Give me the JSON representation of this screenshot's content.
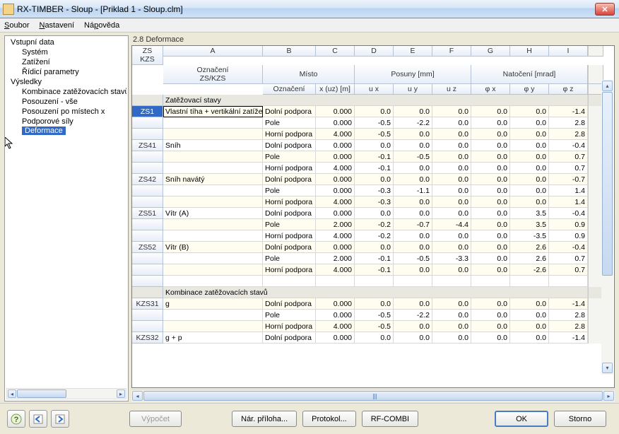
{
  "window": {
    "title": "RX-TIMBER - Sloup - [Priklad 1 - Sloup.clm]"
  },
  "menu": {
    "file": "Soubor",
    "settings": "Nastavení",
    "help": "Nápověda"
  },
  "tree": {
    "group1": "Vstupní data",
    "items1": [
      "Systém",
      "Zatížení",
      "Řídicí parametry"
    ],
    "group2": "Výsledky",
    "items2": [
      "Kombinace zatěžovacích stavů",
      "Posouzení - vše",
      "Posouzení po místech x",
      "Podporové síly",
      "Deformace"
    ]
  },
  "panel_title": "2.8 Deformace",
  "columns": {
    "letters": [
      "A",
      "B",
      "C",
      "D",
      "E",
      "F",
      "G",
      "H",
      "I"
    ],
    "corner": "ZS\nKZS",
    "group1": "Označení\nZS/KZS",
    "group2": "Místo",
    "group3": "Posuny [mm]",
    "group4": "Natočení [mrad]",
    "sub": [
      "Označení",
      "x (uz) [m]",
      "u x",
      "u y",
      "u z",
      "φ x",
      "φ y",
      "φ z"
    ]
  },
  "section1": "Zatěžovací stavy",
  "section2": "Kombinace zatěžovacích stavů",
  "rows": [
    {
      "hdr": "ZS1",
      "sel": true,
      "a": "Vlastní tíha + vertikální zatíže",
      "b": "Dolní podpora",
      "c": "0.000",
      "d": "0.0",
      "e": "0.0",
      "f": "0.0",
      "g": "0.0",
      "h": "0.0",
      "i": "-1.4",
      "cream": true
    },
    {
      "hdr": "",
      "a": "",
      "b": "Pole",
      "c": "0.000",
      "d": "-0.5",
      "e": "-2.2",
      "f": "0.0",
      "g": "0.0",
      "h": "0.0",
      "i": "2.8",
      "cream": false
    },
    {
      "hdr": "",
      "a": "",
      "b": "Horní podpora",
      "c": "4.000",
      "d": "-0.5",
      "e": "0.0",
      "f": "0.0",
      "g": "0.0",
      "h": "0.0",
      "i": "2.8",
      "cream": true
    },
    {
      "hdr": "ZS41",
      "a": "Sníh",
      "b": "Dolní podpora",
      "c": "0.000",
      "d": "0.0",
      "e": "0.0",
      "f": "0.0",
      "g": "0.0",
      "h": "0.0",
      "i": "-0.4",
      "cream": false
    },
    {
      "hdr": "",
      "a": "",
      "b": "Pole",
      "c": "0.000",
      "d": "-0.1",
      "e": "-0.5",
      "f": "0.0",
      "g": "0.0",
      "h": "0.0",
      "i": "0.7",
      "cream": true
    },
    {
      "hdr": "",
      "a": "",
      "b": "Horní podpora",
      "c": "4.000",
      "d": "-0.1",
      "e": "0.0",
      "f": "0.0",
      "g": "0.0",
      "h": "0.0",
      "i": "0.7",
      "cream": false
    },
    {
      "hdr": "ZS42",
      "a": "Sníh navátý",
      "b": "Dolní podpora",
      "c": "0.000",
      "d": "0.0",
      "e": "0.0",
      "f": "0.0",
      "g": "0.0",
      "h": "0.0",
      "i": "-0.7",
      "cream": true
    },
    {
      "hdr": "",
      "a": "",
      "b": "Pole",
      "c": "0.000",
      "d": "-0.3",
      "e": "-1.1",
      "f": "0.0",
      "g": "0.0",
      "h": "0.0",
      "i": "1.4",
      "cream": false
    },
    {
      "hdr": "",
      "a": "",
      "b": "Horní podpora",
      "c": "4.000",
      "d": "-0.3",
      "e": "0.0",
      "f": "0.0",
      "g": "0.0",
      "h": "0.0",
      "i": "1.4",
      "cream": true
    },
    {
      "hdr": "ZS51",
      "a": "Vítr (A)",
      "b": "Dolní podpora",
      "c": "0.000",
      "d": "0.0",
      "e": "0.0",
      "f": "0.0",
      "g": "0.0",
      "h": "3.5",
      "i": "-0.4",
      "cream": false
    },
    {
      "hdr": "",
      "a": "",
      "b": "Pole",
      "c": "2.000",
      "d": "-0.2",
      "e": "-0.7",
      "f": "-4.4",
      "g": "0.0",
      "h": "3.5",
      "i": "0.9",
      "cream": true
    },
    {
      "hdr": "",
      "a": "",
      "b": "Horní podpora",
      "c": "4.000",
      "d": "-0.2",
      "e": "0.0",
      "f": "0.0",
      "g": "0.0",
      "h": "-3.5",
      "i": "0.9",
      "cream": false
    },
    {
      "hdr": "ZS52",
      "a": "Vítr (B)",
      "b": "Dolní podpora",
      "c": "0.000",
      "d": "0.0",
      "e": "0.0",
      "f": "0.0",
      "g": "0.0",
      "h": "2.6",
      "i": "-0.4",
      "cream": true
    },
    {
      "hdr": "",
      "a": "",
      "b": "Pole",
      "c": "2.000",
      "d": "-0.1",
      "e": "-0.5",
      "f": "-3.3",
      "g": "0.0",
      "h": "2.6",
      "i": "0.7",
      "cream": false
    },
    {
      "hdr": "",
      "a": "",
      "b": "Horní podpora",
      "c": "4.000",
      "d": "-0.1",
      "e": "0.0",
      "f": "0.0",
      "g": "0.0",
      "h": "-2.6",
      "i": "0.7",
      "cream": true
    }
  ],
  "rows2": [
    {
      "hdr": "KZS31",
      "a": "g",
      "b": "Dolní podpora",
      "c": "0.000",
      "d": "0.0",
      "e": "0.0",
      "f": "0.0",
      "g": "0.0",
      "h": "0.0",
      "i": "-1.4",
      "cream": true
    },
    {
      "hdr": "",
      "a": "",
      "b": "Pole",
      "c": "0.000",
      "d": "-0.5",
      "e": "-2.2",
      "f": "0.0",
      "g": "0.0",
      "h": "0.0",
      "i": "2.8",
      "cream": false
    },
    {
      "hdr": "",
      "a": "",
      "b": "Horní podpora",
      "c": "4.000",
      "d": "-0.5",
      "e": "0.0",
      "f": "0.0",
      "g": "0.0",
      "h": "0.0",
      "i": "2.8",
      "cream": true
    },
    {
      "hdr": "KZS32",
      "a": "g + p",
      "b": "Dolní podpora",
      "c": "0.000",
      "d": "0.0",
      "e": "0.0",
      "f": "0.0",
      "g": "0.0",
      "h": "0.0",
      "i": "-1.4",
      "cream": false
    }
  ],
  "buttons": {
    "calc": "Výpočet",
    "plan": "Nár. příloha...",
    "proto": "Protokol...",
    "rfcombi": "RF-COMBI",
    "ok": "OK",
    "cancel": "Storno"
  }
}
